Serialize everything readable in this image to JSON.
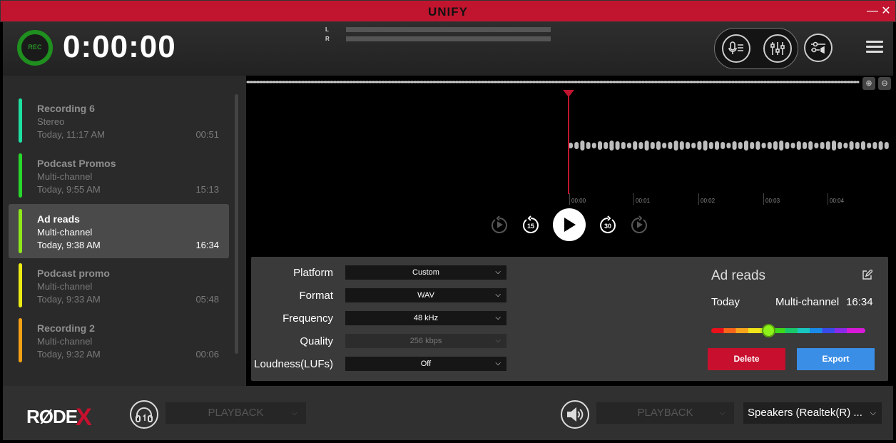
{
  "app": {
    "title": "UNIFY",
    "minimize_icon": "minimize-icon",
    "close_icon": "close-icon"
  },
  "topbar": {
    "rec_label": "REC",
    "timer": "0:00:00",
    "meter_left": "L",
    "meter_right": "R"
  },
  "recordings": [
    {
      "name": "Recording 6",
      "type": "Stereo",
      "date": "Today, 11:17 AM",
      "duration": "00:51",
      "color": "#1de0a0"
    },
    {
      "name": "Podcast Promos",
      "type": "Multi-channel",
      "date": "Today, 9:55 AM",
      "duration": "15:13",
      "color": "#28d62c"
    },
    {
      "name": "Ad reads",
      "type": "Multi-channel",
      "date": "Today, 9:38 AM",
      "duration": "16:34",
      "color": "#8ee81a"
    },
    {
      "name": "Podcast promo",
      "type": "Multi-channel",
      "date": "Today, 9:33 AM",
      "duration": "05:48",
      "color": "#ecec14"
    },
    {
      "name": "Recording 2",
      "type": "Multi-channel",
      "date": "Today, 9:32 AM",
      "duration": "00:06",
      "color": "#f5a015"
    }
  ],
  "timeline": {
    "ticks": [
      "00:00",
      "00:01",
      "00:02",
      "00:03",
      "00:04"
    ]
  },
  "transport": {
    "skip_back_15": "15",
    "skip_fwd_30": "30"
  },
  "export": {
    "fields": [
      {
        "label": "Platform",
        "value": "Custom",
        "disabled": false
      },
      {
        "label": "Format",
        "value": "WAV",
        "disabled": false
      },
      {
        "label": "Frequency",
        "value": "48 kHz",
        "disabled": false
      },
      {
        "label": "Quality",
        "value": "256 kbps",
        "disabled": true
      },
      {
        "label": "Loudness(LUFs)",
        "value": "Off",
        "disabled": false
      }
    ],
    "detail": {
      "title": "Ad reads",
      "date": "Today",
      "type": "Multi-channel",
      "duration": "16:34"
    },
    "delete_label": "Delete",
    "export_label": "Export"
  },
  "bottom": {
    "logo_text": "RØDE",
    "logo_x": "X",
    "headphone_output": "PLAYBACK",
    "speaker_output": "PLAYBACK",
    "speaker_device": "Speakers (Realtek(R) ..."
  },
  "colors": {
    "titlebar": "#c1152f",
    "accent_red": "#c8102e",
    "export_blue": "#3a8ee6",
    "rec_green": "#1f8f1f"
  }
}
